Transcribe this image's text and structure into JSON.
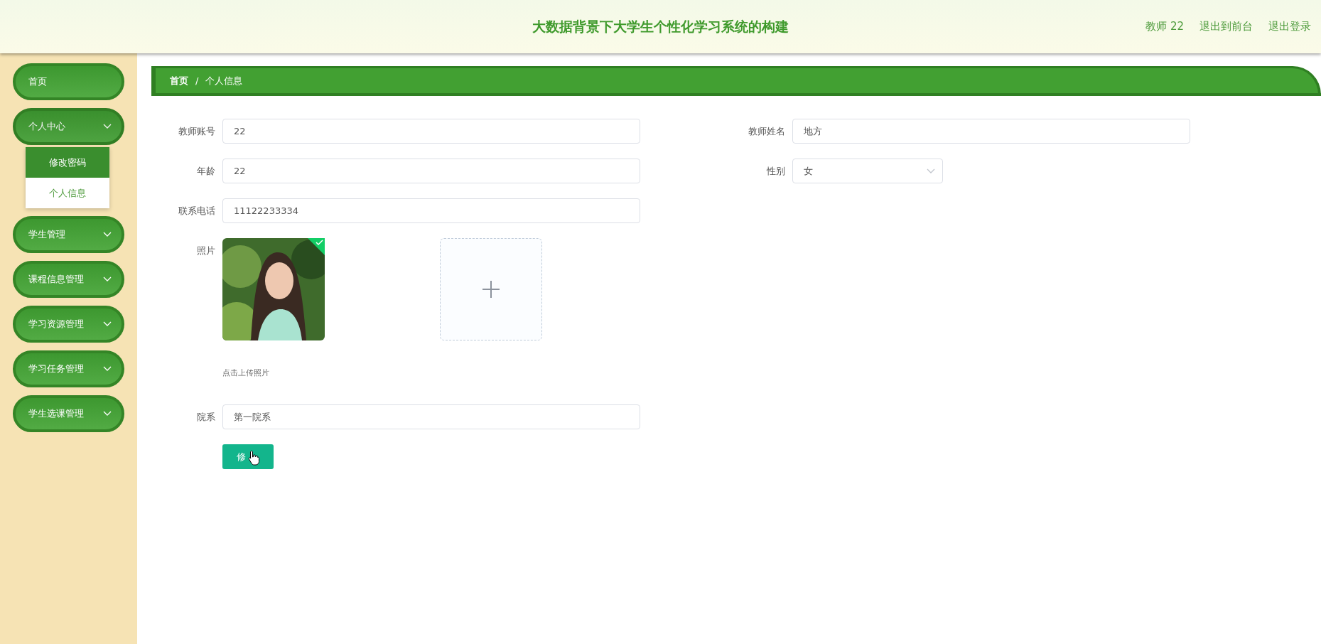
{
  "header": {
    "title": "大数据背景下大学生个性化学习系统的构建",
    "links": [
      "教师 22",
      "退出到前台",
      "退出登录"
    ]
  },
  "sidebar": {
    "items": [
      {
        "label": "首页"
      },
      {
        "label": "个人中心",
        "expanded": true,
        "children": [
          {
            "label": "修改密码",
            "selected": false
          },
          {
            "label": "个人信息",
            "selected": true
          }
        ]
      },
      {
        "label": "学生管理",
        "expanded": false
      },
      {
        "label": "课程信息管理",
        "expanded": false
      },
      {
        "label": "学习资源管理",
        "expanded": false
      },
      {
        "label": "学习任务管理",
        "expanded": false
      },
      {
        "label": "学生选课管理",
        "expanded": false
      }
    ]
  },
  "breadcrumb": {
    "items": [
      "首页",
      "个人信息"
    ],
    "separator": "/"
  },
  "form": {
    "account": {
      "label": "教师账号",
      "value": "22"
    },
    "name": {
      "label": "教师姓名",
      "value": "地方"
    },
    "age": {
      "label": "年龄",
      "value": "22"
    },
    "gender": {
      "label": "性别",
      "value": "女"
    },
    "phone": {
      "label": "联系电话",
      "value": "11122233334"
    },
    "photo": {
      "label": "照片",
      "kind": "picture",
      "uploaded": true,
      "hint": "点击上传照片"
    },
    "department": {
      "label": "院系",
      "value": "第一院系"
    },
    "submit": "修"
  }
}
